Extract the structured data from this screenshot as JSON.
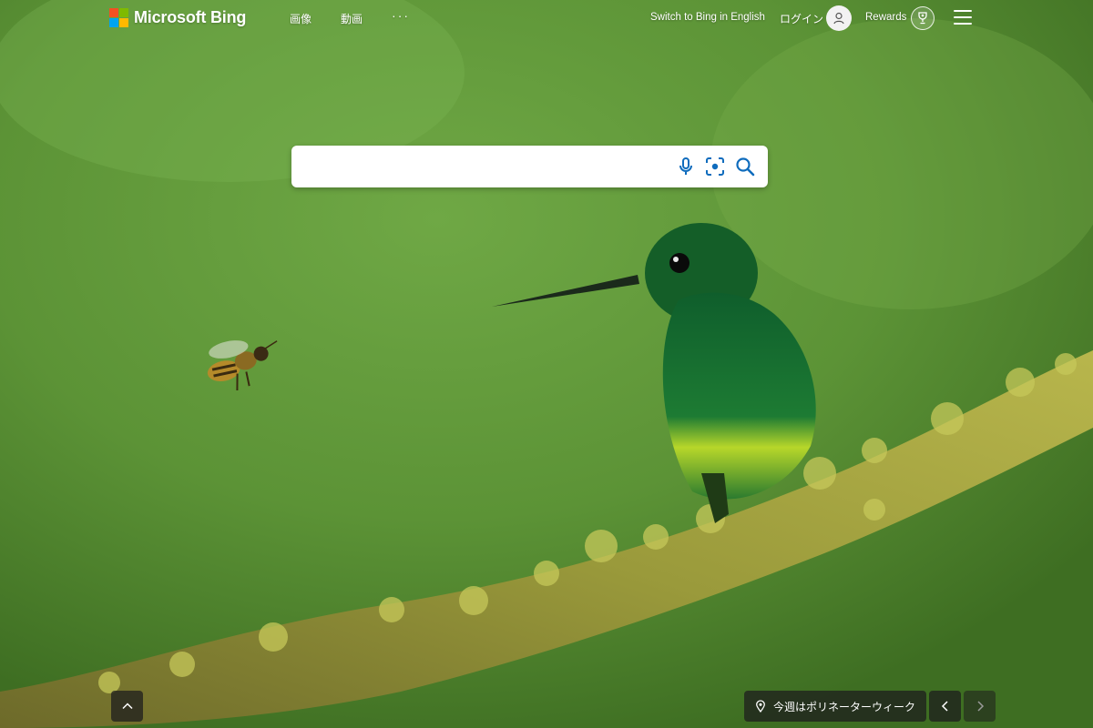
{
  "brand": {
    "name": "Microsoft Bing",
    "colors": [
      "#f25022",
      "#7fba00",
      "#00a4ef",
      "#ffb900"
    ]
  },
  "nav": {
    "items": [
      {
        "label": "画像"
      },
      {
        "label": "動画"
      },
      {
        "label": "···"
      }
    ]
  },
  "header_right": {
    "switch_language": "Switch to Bing in English",
    "login": "ログイン",
    "rewards": "Rewards",
    "menu_icon": "hamburger-icon",
    "avatar_icon": "person-icon",
    "rewards_icon": "trophy-icon"
  },
  "search": {
    "value": "",
    "placeholder": "",
    "icons": [
      "microphone-icon",
      "visual-search-icon",
      "search-icon"
    ],
    "accent": "#0f6cbd"
  },
  "image_caption": {
    "text": "今週はポリネーターウィーク",
    "icon": "location-pin-icon"
  },
  "controls": {
    "scroll_up_icon": "chevron-up-icon",
    "prev_icon": "chevron-left-icon",
    "next_icon": "chevron-right-icon"
  }
}
